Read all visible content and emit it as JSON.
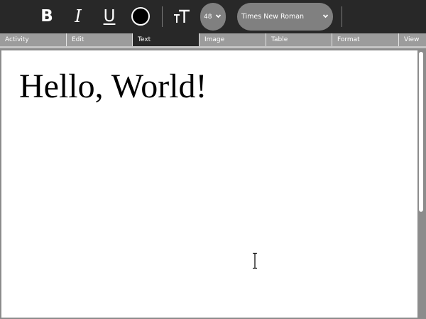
{
  "toolbar": {
    "bold_label": "B",
    "italic_label": "I",
    "underline_label": "U",
    "text_color": "#000000",
    "font_size": "48",
    "font_family": "Times New Roman",
    "icons": {
      "text_size": "text-size-icon",
      "dropdown": "chevron-down-icon"
    }
  },
  "tabs": [
    {
      "label": "Activity"
    },
    {
      "label": "Edit"
    },
    {
      "label": "Text",
      "active": true
    },
    {
      "label": "Image"
    },
    {
      "label": "Table"
    },
    {
      "label": "Format"
    },
    {
      "label": "View"
    }
  ],
  "document": {
    "text": "Hello, World!"
  },
  "colors": {
    "toolbar_bg": "#282828",
    "tab_bg": "#9c9c9c",
    "active_tab_bg": "#282828",
    "canvas_bg": "#ffffff",
    "combo_bg": "#808080"
  }
}
